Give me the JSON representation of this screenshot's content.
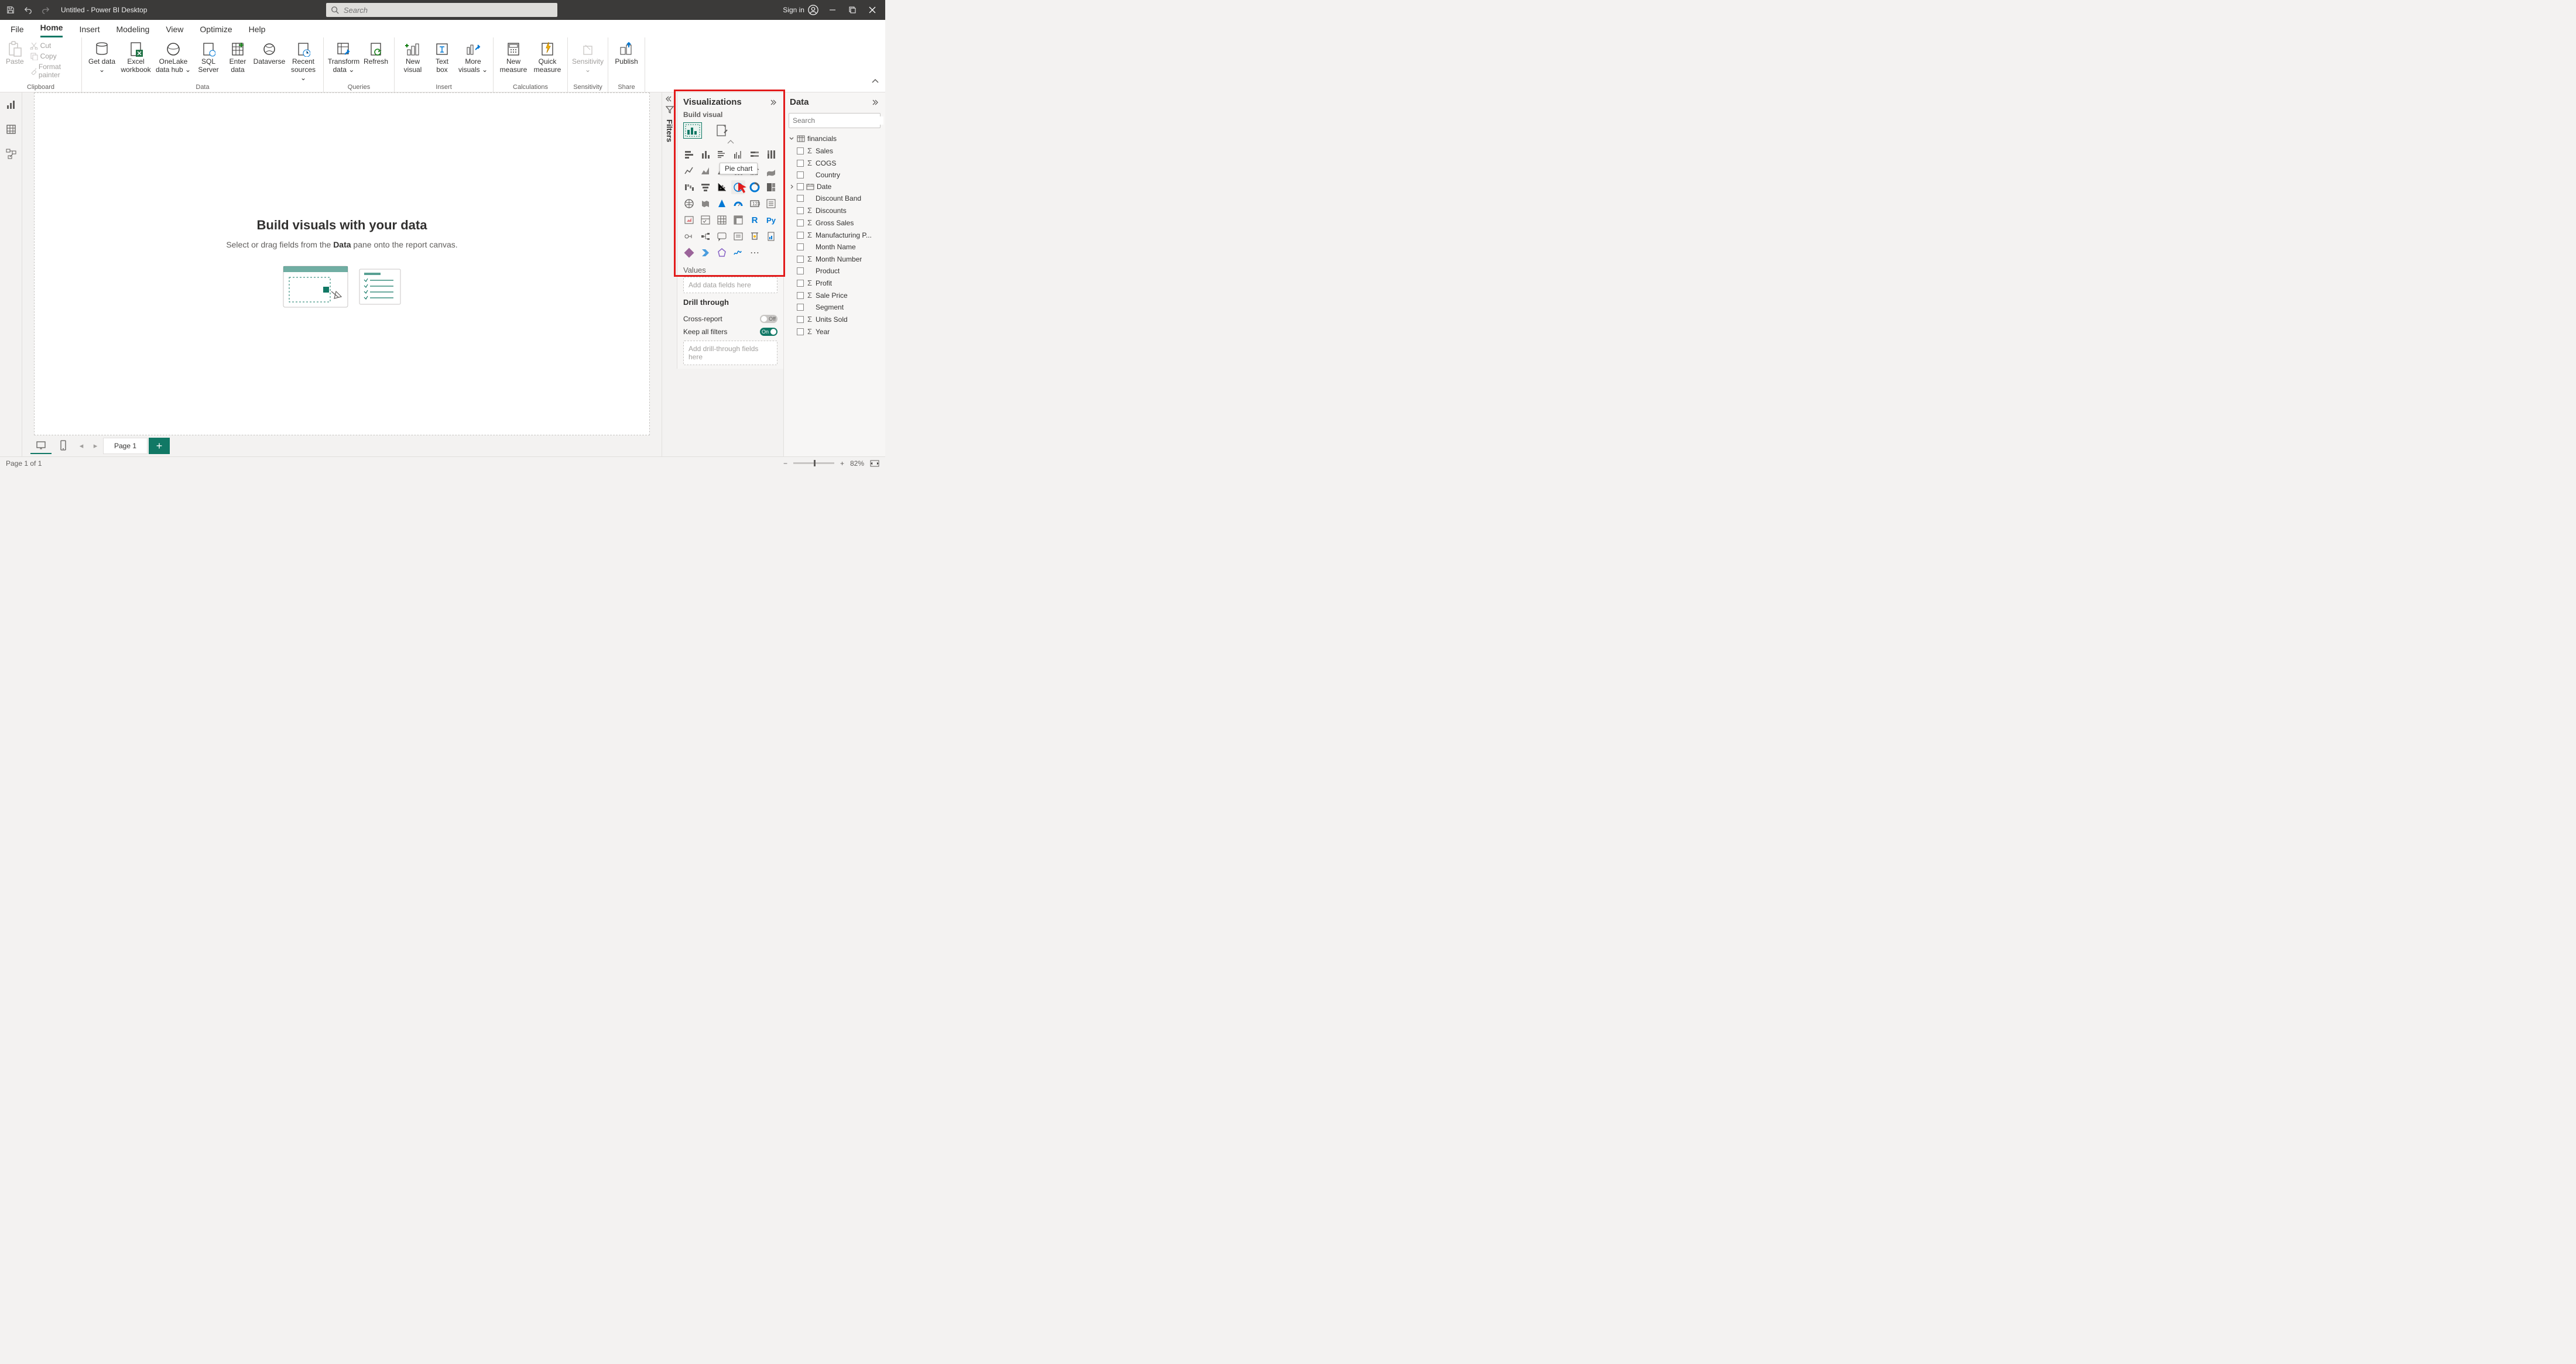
{
  "titlebar": {
    "title": "Untitled - Power BI Desktop",
    "search_placeholder": "Search",
    "signin": "Sign in"
  },
  "tabs": {
    "file": "File",
    "home": "Home",
    "insert": "Insert",
    "modeling": "Modeling",
    "view": "View",
    "optimize": "Optimize",
    "help": "Help"
  },
  "ribbon": {
    "paste": "Paste",
    "cut": "Cut",
    "copy": "Copy",
    "format_painter": "Format painter",
    "clipboard": "Clipboard",
    "get_data": "Get data",
    "excel": "Excel workbook",
    "onelake": "OneLake data hub",
    "sql": "SQL Server",
    "enter": "Enter data",
    "dataverse": "Dataverse",
    "recent": "Recent sources",
    "data": "Data",
    "transform": "Transform data",
    "refresh": "Refresh",
    "queries": "Queries",
    "new_visual": "New visual",
    "text_box": "Text box",
    "more_visuals": "More visuals",
    "insert": "Insert",
    "new_measure": "New measure",
    "quick_measure": "Quick measure",
    "calcs": "Calculations",
    "sensitivity": "Sensitivity",
    "sens_grp": "Sensitivity",
    "publish": "Publish",
    "share": "Share"
  },
  "filters_label": "Filters",
  "canvas": {
    "heading": "Build visuals with your data",
    "sub_pre": "Select or drag fields from the ",
    "sub_bold": "Data",
    "sub_post": " pane onto the report canvas."
  },
  "pagebar": {
    "page1": "Page 1"
  },
  "viz": {
    "title": "Visualizations",
    "build": "Build visual",
    "tooltip": "Pie chart",
    "values": "Values",
    "values_drop": "Add data fields here",
    "drill": "Drill through",
    "cross": "Cross-report",
    "off": "Off",
    "keep": "Keep all filters",
    "on": "On",
    "drill_drop": "Add drill-through fields here"
  },
  "datapane": {
    "title": "Data",
    "search_placeholder": "Search",
    "table": "financials",
    "fields": [
      {
        "name": "Sales",
        "sigma": true
      },
      {
        "name": "COGS",
        "sigma": true
      },
      {
        "name": "Country",
        "sigma": false
      },
      {
        "name": "Date",
        "sigma": false,
        "date": true,
        "expand": true
      },
      {
        "name": "Discount Band",
        "sigma": false
      },
      {
        "name": "Discounts",
        "sigma": true
      },
      {
        "name": "Gross Sales",
        "sigma": true
      },
      {
        "name": "Manufacturing P...",
        "sigma": true
      },
      {
        "name": "Month Name",
        "sigma": false
      },
      {
        "name": "Month Number",
        "sigma": true
      },
      {
        "name": "Product",
        "sigma": false
      },
      {
        "name": "Profit",
        "sigma": true
      },
      {
        "name": "Sale Price",
        "sigma": true
      },
      {
        "name": "Segment",
        "sigma": false
      },
      {
        "name": "Units Sold",
        "sigma": true
      },
      {
        "name": "Year",
        "sigma": true
      }
    ]
  },
  "status": {
    "page": "Page 1 of 1",
    "zoom": "82%"
  }
}
